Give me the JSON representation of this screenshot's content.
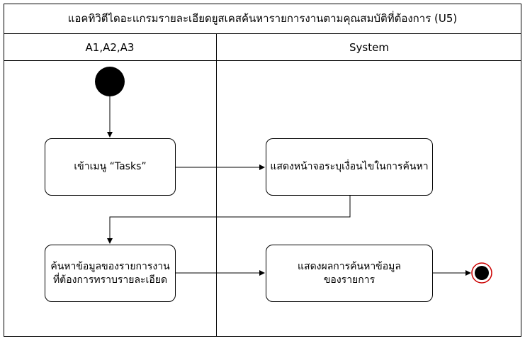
{
  "diagram": {
    "title": "แอคทิวิตีไดอะแกรมรายละเอียดยูสเคสค้นหารายการงานตามคุณสมบัติที่ต้องการ (U5)",
    "lanes": [
      {
        "label": "A1,A2,A3"
      },
      {
        "label": "System"
      }
    ],
    "nodes": {
      "enter_menu": "เข้าเมนู “Tasks”",
      "show_search": "แสดงหน้าจอระบุเงื่อนไขในการค้นหา",
      "search_info": "ค้นหาข้อมูลของรายการงานที่ต้องการทราบรายละเอียด",
      "show_result": "แสดงผลการค้นหาข้อมูลของรายการ"
    },
    "colors": {
      "line": "#000000",
      "final_ring": "#cc0000"
    }
  }
}
